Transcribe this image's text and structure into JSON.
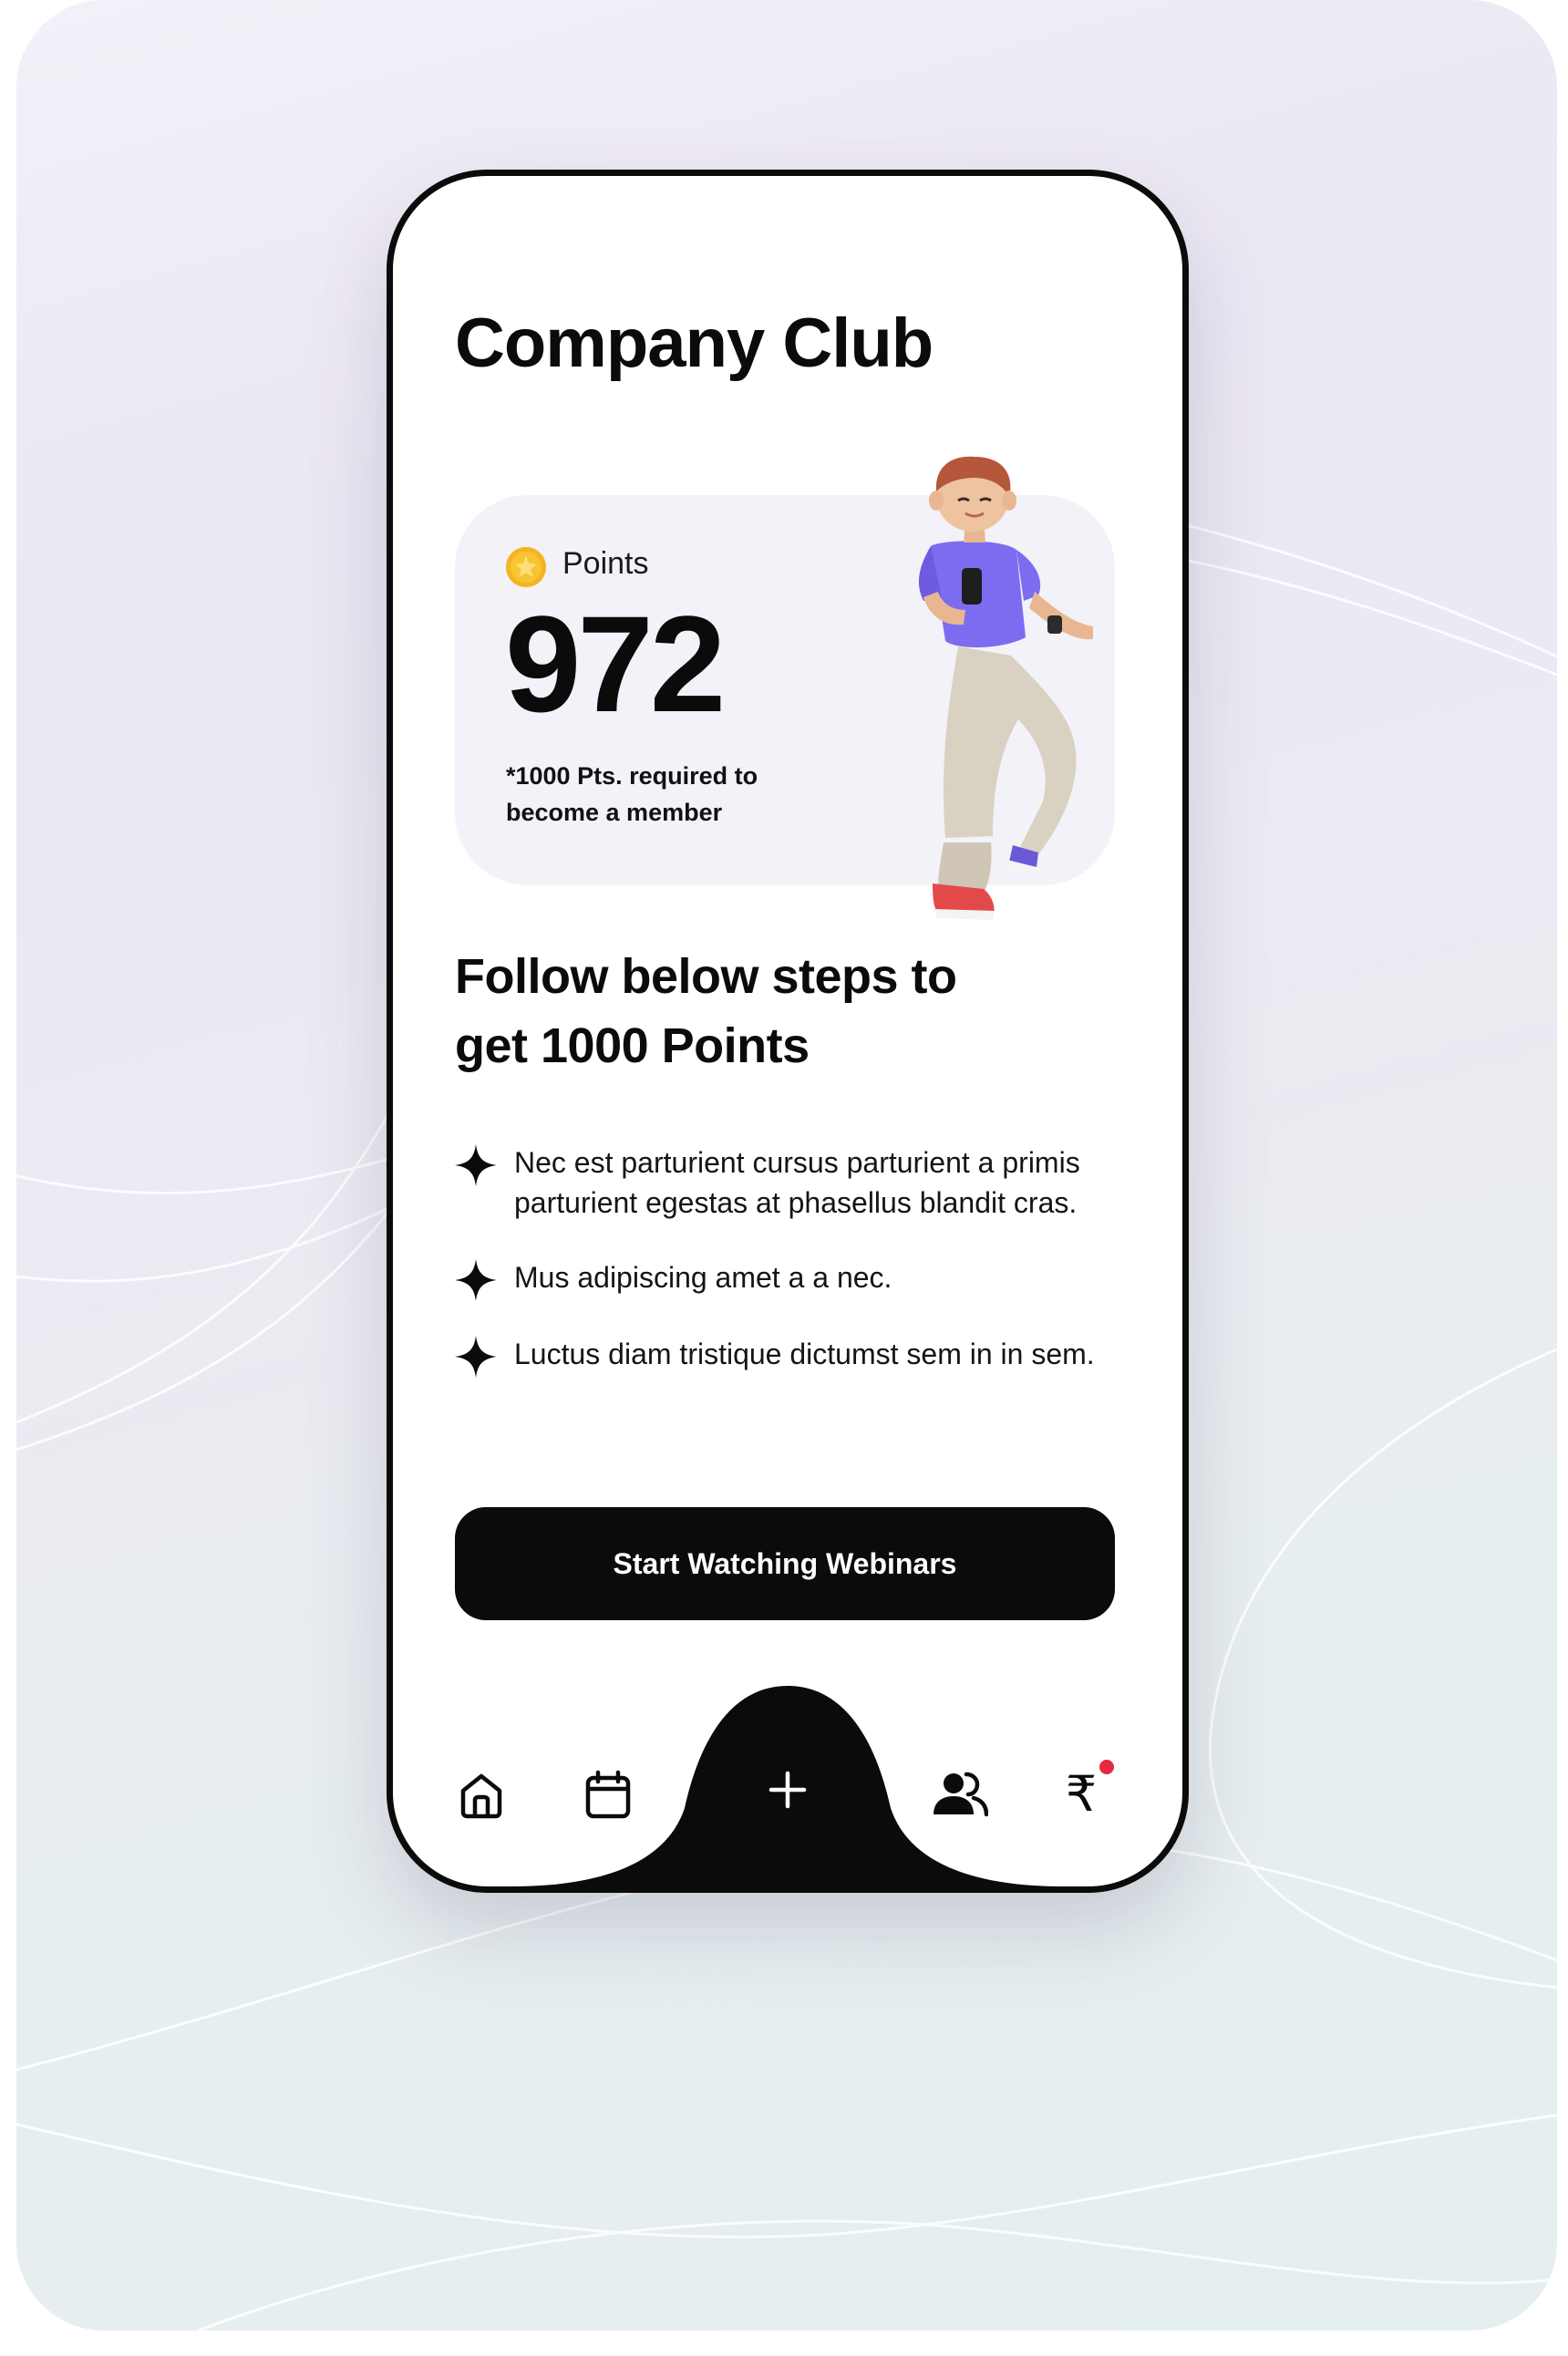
{
  "app": {
    "title": "Company Club"
  },
  "points_card": {
    "label": "Points",
    "value": "972",
    "note": "*1000 Pts. required to become a member"
  },
  "steps": {
    "title": "Follow below steps to get 1000 Points",
    "items": [
      {
        "text": "Nec est parturient cursus parturient a primis parturient egestas at phasellus blandit cras."
      },
      {
        "text": "Mus adipiscing amet a a nec."
      },
      {
        "text": "Luctus diam tristique dictumst sem in in sem."
      }
    ]
  },
  "cta": {
    "label": "Start Watching Webinars"
  },
  "nav": {
    "rupee_symbol": "₹",
    "icons": [
      "home-icon",
      "calendar-icon",
      "plus-icon",
      "users-icon",
      "rupee-icon"
    ]
  },
  "colors": {
    "primary": "#0b0b0b",
    "card_bg": "#f3f2f8",
    "coin": "#f7c531",
    "notification_dot": "#e5293e"
  }
}
